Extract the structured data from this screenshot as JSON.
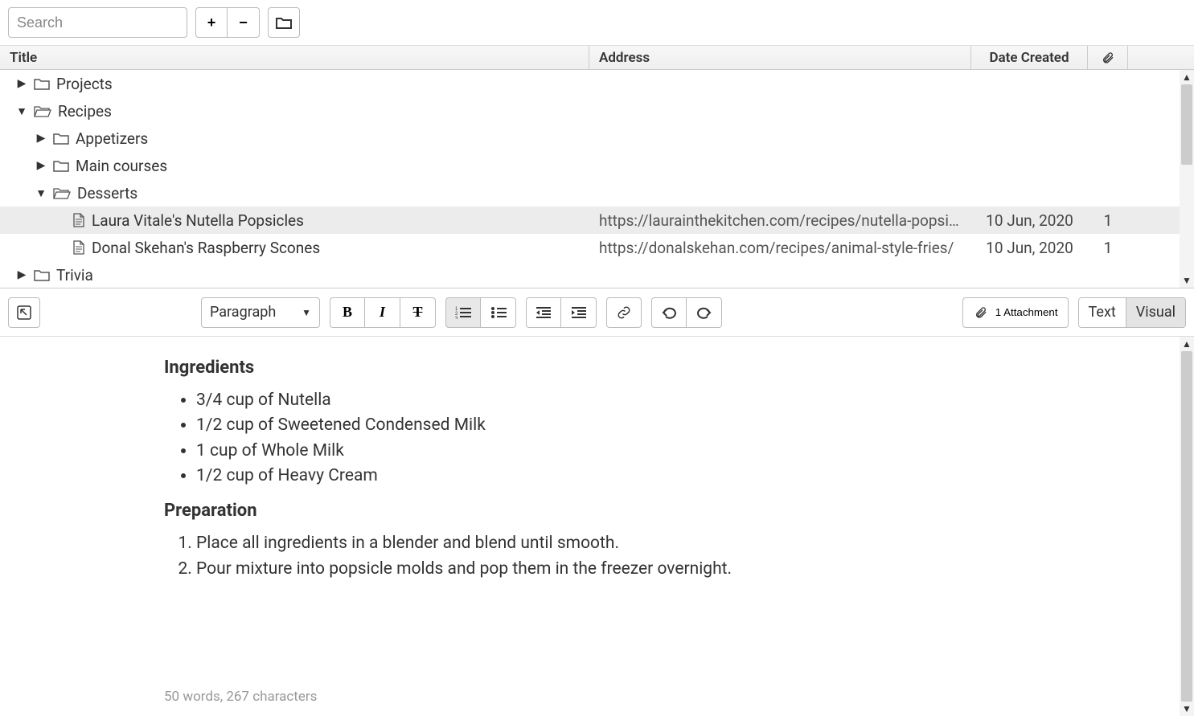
{
  "topbar": {
    "search_placeholder": "Search",
    "plus": "+",
    "minus": "−"
  },
  "headers": {
    "title": "Title",
    "address": "Address",
    "date": "Date Created"
  },
  "tree": [
    {
      "indent": 0,
      "toggle": "▶",
      "icon": "folder",
      "label": "Projects",
      "addr": "",
      "date": "",
      "att": ""
    },
    {
      "indent": 0,
      "toggle": "▼",
      "icon": "folder-open",
      "label": "Recipes",
      "addr": "",
      "date": "",
      "att": ""
    },
    {
      "indent": 1,
      "toggle": "▶",
      "icon": "folder",
      "label": "Appetizers",
      "addr": "",
      "date": "",
      "att": ""
    },
    {
      "indent": 1,
      "toggle": "▶",
      "icon": "folder",
      "label": "Main courses",
      "addr": "",
      "date": "",
      "att": ""
    },
    {
      "indent": 1,
      "toggle": "▼",
      "icon": "folder-open",
      "label": "Desserts",
      "addr": "",
      "date": "",
      "att": ""
    },
    {
      "indent": 2,
      "toggle": "",
      "icon": "file",
      "label": "Laura Vitale's Nutella Popsicles",
      "addr": "https://laurainthekitchen.com/recipes/nutella-popsicles/",
      "date": "10 Jun, 2020",
      "att": "1",
      "selected": true
    },
    {
      "indent": 2,
      "toggle": "",
      "icon": "file",
      "label": "Donal Skehan's Raspberry Scones",
      "addr": "https://donalskehan.com/recipes/animal-style-fries/",
      "date": "10 Jun, 2020",
      "att": "1"
    },
    {
      "indent": 0,
      "toggle": "▶",
      "icon": "folder",
      "label": "Trivia",
      "addr": "",
      "date": "",
      "att": ""
    }
  ],
  "editor_toolbar": {
    "paragraph": "Paragraph",
    "attachment": "1 Attachment",
    "text_tab": "Text",
    "visual_tab": "Visual"
  },
  "content": {
    "h_ingredients": "Ingredients",
    "ingredients": [
      "3/4 cup of Nutella",
      "1/2 cup of Sweetened Condensed Milk",
      "1 cup of Whole Milk",
      "1/2 cup of Heavy Cream"
    ],
    "h_preparation": "Preparation",
    "steps": [
      "Place all ingredients in a blender and blend until smooth.",
      "Pour mixture into popsicle molds and pop them in the freezer overnight."
    ]
  },
  "status": "50 words, 267 characters"
}
